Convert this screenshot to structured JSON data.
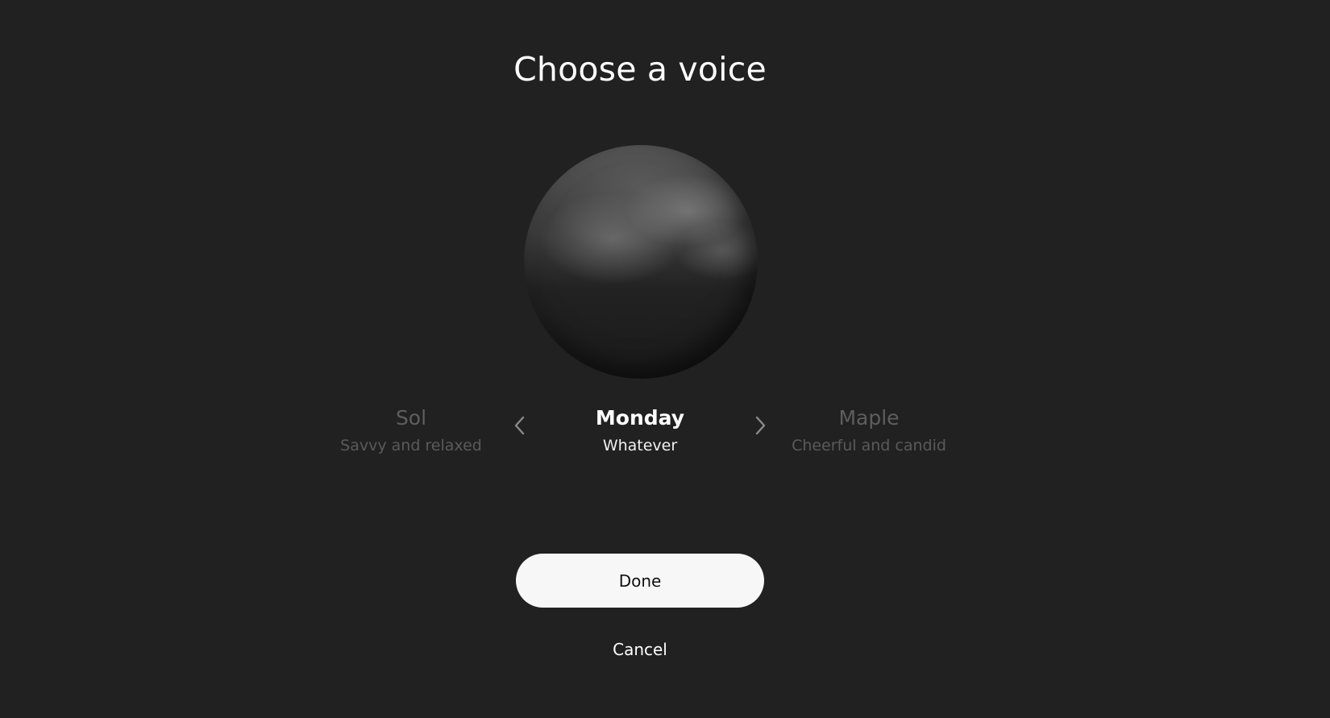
{
  "dialog": {
    "title": "Choose a voice"
  },
  "voices": {
    "previous": {
      "name": "Sol",
      "description": "Savvy and relaxed"
    },
    "current": {
      "name": "Monday",
      "description": "Whatever"
    },
    "next": {
      "name": "Maple",
      "description": "Cheerful and candid"
    }
  },
  "icons": {
    "previous": "chevron-left-icon",
    "next": "chevron-right-icon"
  },
  "actions": {
    "done_label": "Done",
    "cancel_label": "Cancel"
  },
  "colors": {
    "background": "#212121",
    "primary_button": "#f7f7f7",
    "dimmed_text": "#5e5e5e"
  }
}
